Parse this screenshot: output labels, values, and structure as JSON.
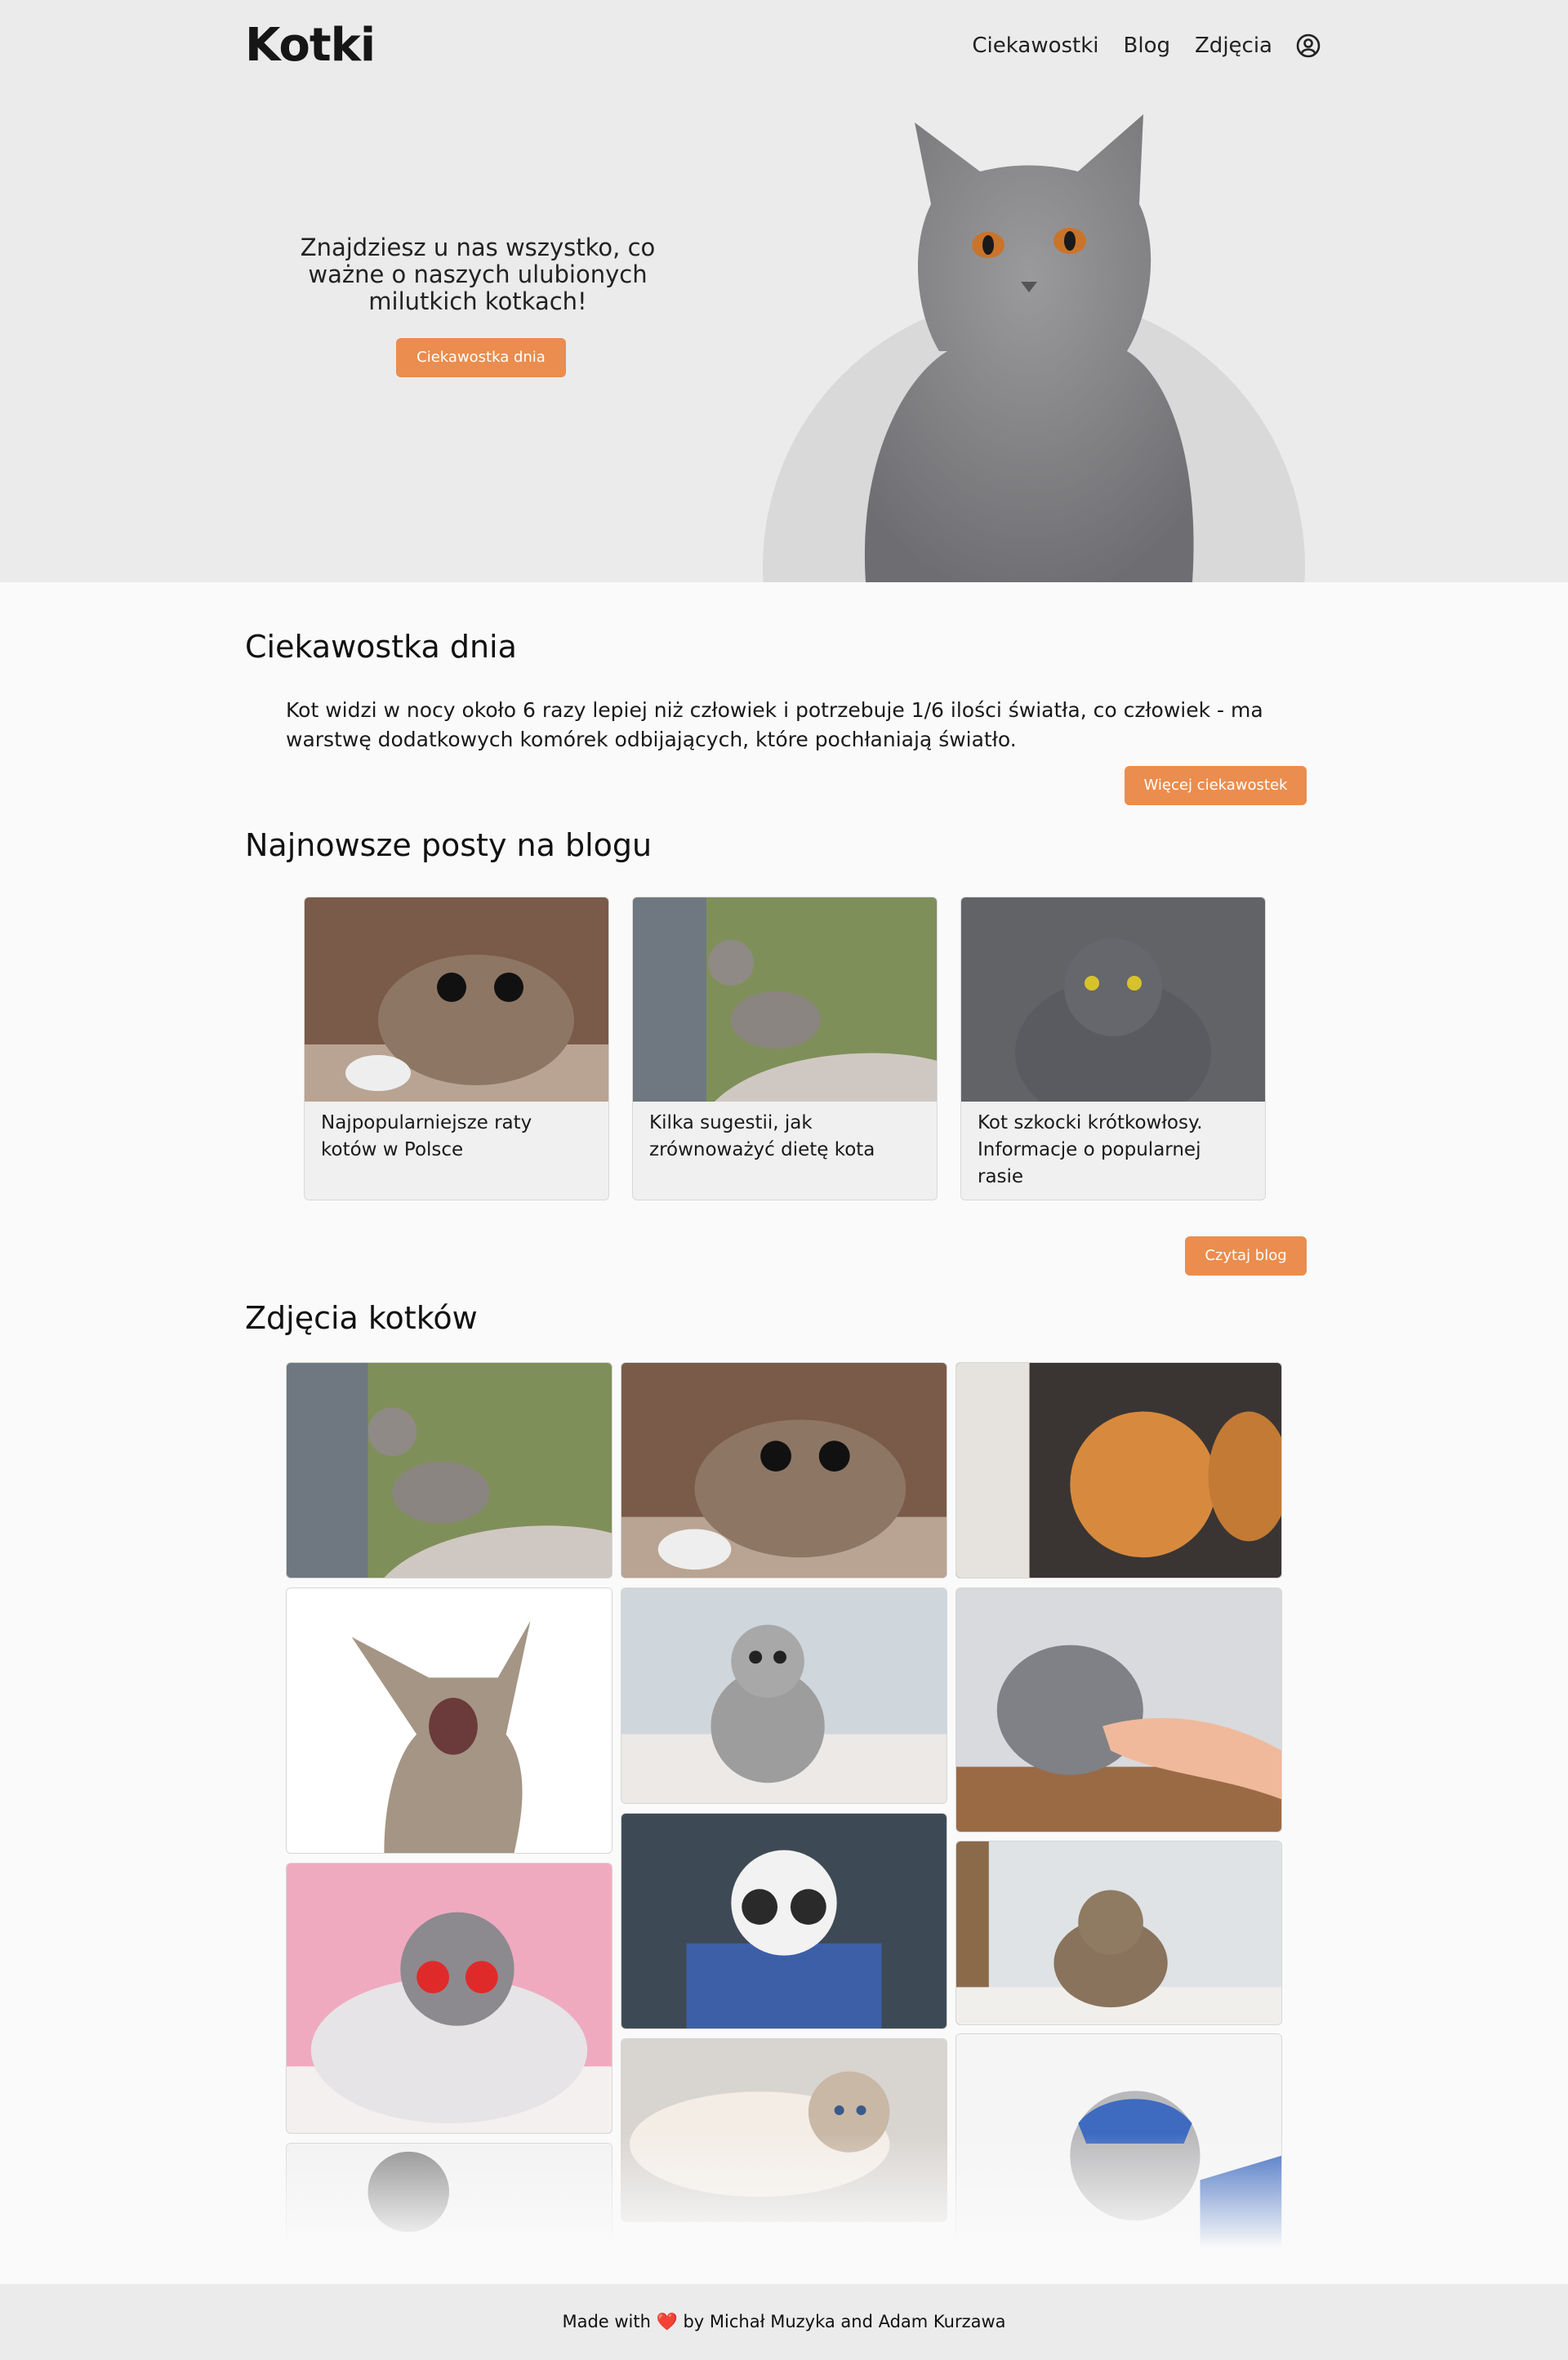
{
  "header": {
    "logo": "Kotki",
    "nav": [
      "Ciekawostki",
      "Blog",
      "Zdjęcia"
    ],
    "user_icon": "user-circle-icon"
  },
  "hero": {
    "text": "Znajdziesz u nas wszystko, co ważne o naszych ulubionych milutkich kotkach!",
    "button": "Ciekawostka dnia",
    "image": "grey-british-shorthair-cat"
  },
  "fact": {
    "title": "Ciekawostka dnia",
    "text": "Kot widzi w nocy około 6 razy lepiej niż człowiek i potrzebuje 1/6 ilości światła, co człowiek - ma warstwę dodatkowych komórek odbijających, które pochłaniają światło.",
    "button": "Więcej ciekawostek"
  },
  "blog": {
    "title": "Najnowsze posty na blogu",
    "posts": [
      {
        "title": "Najpopularniejsze raty kotów w Polsce",
        "image": "tabby-cat-crouching"
      },
      {
        "title": "Kilka sugestii, jak zrównoważyć dietę kota",
        "image": "tabby-kitten-on-rock"
      },
      {
        "title": "Kot szkocki krótkowłosy. Informacje o popularnej rasie",
        "image": "grey-scottish-fold"
      }
    ],
    "button": "Czytaj blog"
  },
  "gallery": {
    "title": "Zdjęcia kotków",
    "photos": [
      "tabby-kitten-on-rock",
      "tabby-cat-crouching",
      "ginger-cat",
      "meowing-cat-white-background",
      "silver-tabby-kitten",
      "grey-cat-petted",
      "cat-with-heart-sunglasses",
      "cat-with-round-sunglasses",
      "fluffy-brown-kitten",
      "ragdoll-cat-lying",
      "cat-with-blue-mask",
      "faded-grey-cat"
    ]
  },
  "footer": {
    "prefix": "Made with",
    "heart": "❤️",
    "suffix": "by Michał Muzyka and Adam Kurzawa"
  },
  "colors": {
    "accent": "#ea8d4e",
    "hero_bg": "#ebebeb",
    "page_bg": "#fafafa"
  }
}
